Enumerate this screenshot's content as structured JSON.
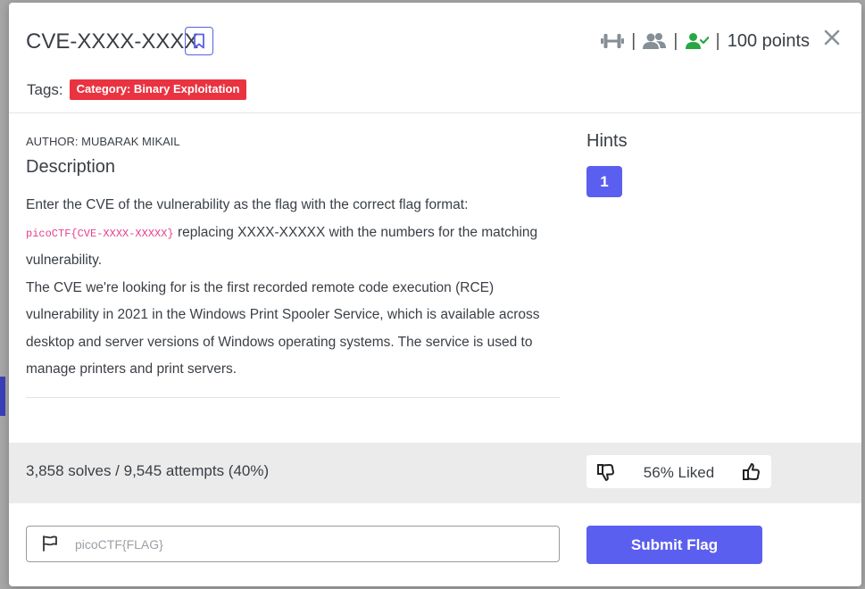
{
  "challenge": {
    "title": "CVE-XXXX-XXXX",
    "points": "100 points",
    "tags_label": "Tags:",
    "tag": "Category: Binary Exploitation",
    "author": "AUTHOR: MUBARAK MIKAIL",
    "description_title": "Description",
    "description": {
      "line1": "Enter the CVE of the vulnerability as the flag with the correct flag format:",
      "flag_format": "picoCTF{CVE-XXXX-XXXXX}",
      "line2": " replacing XXXX-XXXXX with the numbers for the matching vulnerability.",
      "paragraph2": "The CVE we're looking for is the first recorded remote code execution (RCE) vulnerability in 2021 in the Windows Print Spooler Service, which is available across desktop and server versions of Windows operating systems. The service is used to manage printers and print servers."
    }
  },
  "hints": {
    "title": "Hints",
    "items": [
      "1"
    ]
  },
  "stats": {
    "solves_text": "3,858 solves / 9,545 attempts (40%)",
    "liked": "56% Liked"
  },
  "submit": {
    "placeholder": "picoCTF{FLAG}",
    "value": "",
    "button_label": "Submit Flag"
  },
  "colors": {
    "accent": "#5b5fef",
    "tag_red": "#ea3340",
    "solved_green": "#28a745"
  },
  "icons": {
    "difficulty": "dumbbell-icon",
    "users": "users-icon",
    "solved": "user-check-icon",
    "close": "close-icon",
    "bookmark": "bookmark-icon",
    "flag": "flag-icon",
    "like": "thumbs-up-icon",
    "dislike": "thumbs-down-icon"
  }
}
